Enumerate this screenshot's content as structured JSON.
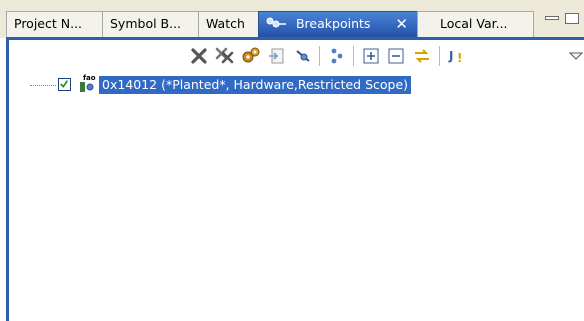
{
  "tabs": [
    {
      "label": "Project N...",
      "active": false
    },
    {
      "label": "Symbol B...",
      "active": false
    },
    {
      "label": "Watch",
      "active": false
    },
    {
      "label": "Breakpoints",
      "active": true
    },
    {
      "label": "Local Var...",
      "active": false
    }
  ],
  "active_tab_close": "✕",
  "toolbar": {
    "icons": [
      "remove-breakpoint-icon",
      "remove-all-breakpoints-icon",
      "breakpoint-properties-icon",
      "go-to-file-icon",
      "skip-all-breakpoints-icon",
      "show-breakpoints-for-target-icon",
      "expand-all-icon",
      "collapse-all-icon",
      "link-with-debug-view-icon",
      "add-java-exception-breakpoint-icon",
      "view-menu-icon"
    ]
  },
  "breakpoints": [
    {
      "label": "0x14012  (*Planted*, Hardware,Restricted Scope)",
      "checked": true
    }
  ],
  "colors": {
    "active_tab": "#2f64b5",
    "selection": "#316ac5",
    "frame": "#2e5fa8",
    "tabstrip_bg": "#ece9d8"
  }
}
